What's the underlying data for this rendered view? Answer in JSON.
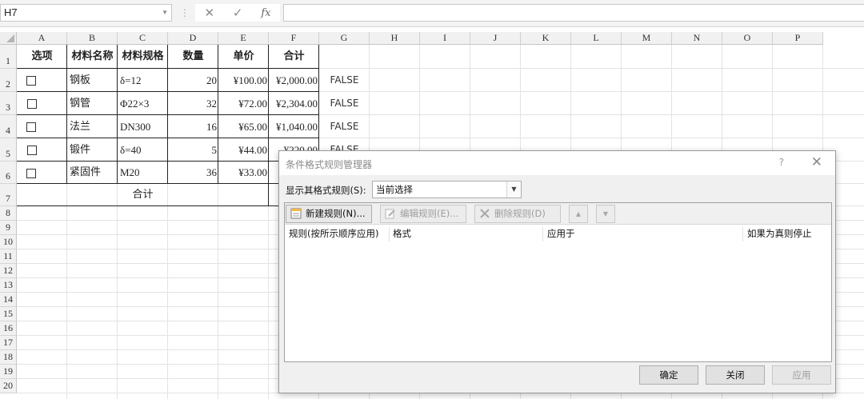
{
  "formula_bar": {
    "name_box": "H7",
    "cancel_symbol": "✕",
    "enter_symbol": "✓",
    "fx_label": "fx",
    "formula": ""
  },
  "columns": [
    "A",
    "B",
    "C",
    "D",
    "E",
    "F",
    "G",
    "H",
    "I",
    "J",
    "K",
    "L",
    "M",
    "N",
    "O",
    "P"
  ],
  "rows": [
    "1",
    "2",
    "3",
    "4",
    "5",
    "6",
    "7",
    "8",
    "9",
    "10",
    "11",
    "12",
    "13",
    "14",
    "15",
    "16",
    "17",
    "18",
    "19",
    "20"
  ],
  "table": {
    "headers": [
      "选项",
      "材料名称",
      "材料规格",
      "数量",
      "单价",
      "合计"
    ],
    "data_rows": [
      {
        "name": "钢板",
        "spec": "δ=12",
        "qty": "20",
        "price": "¥100.00",
        "total": "¥2,000.00",
        "flag": "FALSE"
      },
      {
        "name": "钢管",
        "spec": "Φ22×3",
        "qty": "32",
        "price": "¥72.00",
        "total": "¥2,304.00",
        "flag": "FALSE"
      },
      {
        "name": "法兰",
        "spec": "DN300",
        "qty": "16",
        "price": "¥65.00",
        "total": "¥1,040.00",
        "flag": "FALSE"
      },
      {
        "name": "锻件",
        "spec": "δ=40",
        "qty": "5",
        "price": "¥44.00",
        "total": "¥220.00",
        "flag": "FALSE"
      },
      {
        "name": "紧固件",
        "spec": "M20",
        "qty": "36",
        "price": "¥33.00",
        "total": "",
        "flag": ""
      }
    ],
    "summary_label": "合计"
  },
  "dialog": {
    "title": "条件格式规则管理器",
    "help": "?",
    "close": "✕",
    "show_rules_label": "显示其格式规则(S):",
    "show_rules_value": "当前选择",
    "new_rule": "新建规则(N)...",
    "edit_rule": "编辑规则(E)...",
    "delete_rule": "删除规则(D)",
    "columns": [
      "规则(按所示顺序应用)",
      "格式",
      "应用于",
      "如果为真则停止"
    ],
    "ok": "确定",
    "close_button": "关闭",
    "apply": "应用"
  }
}
